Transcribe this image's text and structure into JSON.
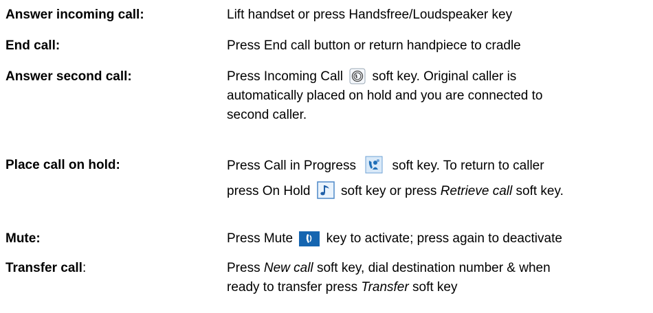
{
  "items": [
    {
      "label": "Answer incoming call:",
      "lines": [
        "Lift handset or press Handsfree/Loudspeaker key"
      ]
    },
    {
      "label": "End call:",
      "lines": [
        "Press End call button or return handpiece to cradle"
      ]
    },
    {
      "label": "Answer second call:",
      "line1_pre": "Press Incoming Call",
      "line1_post": "soft key. Original caller is",
      "line2": "automatically placed on hold and you are connected to",
      "line3": "second caller.",
      "icon": "incoming-call-icon"
    },
    {
      "label": "Place call on hold:",
      "line1_pre": "Press Call in Progress",
      "line1_post": "soft key.  To return to caller",
      "line2_pre": "press On Hold",
      "line2_mid": "soft key or press",
      "line2_ital": "Retrieve call",
      "line2_post": "soft key.",
      "icons": [
        "call-in-progress-icon",
        "on-hold-icon"
      ]
    },
    {
      "label": "Mute:",
      "line1_pre": "Press Mute",
      "line1_post": "key to activate; press again to deactivate",
      "icon": "mute-icon"
    },
    {
      "label_bold": "Transfer call",
      "label_colon": ":",
      "line1_pre": "Press",
      "line1_ital": "New call",
      "line1_post": "soft key, dial destination number & when",
      "line2_pre": "ready to transfer press",
      "line2_ital": "Transfer",
      "line2_post": "soft key"
    }
  ],
  "colors": {
    "text": "#000000",
    "icon_blue": "#1f6fb8",
    "icon_light_blue": "#cfe3f7",
    "mute_bg": "#1565b0"
  }
}
